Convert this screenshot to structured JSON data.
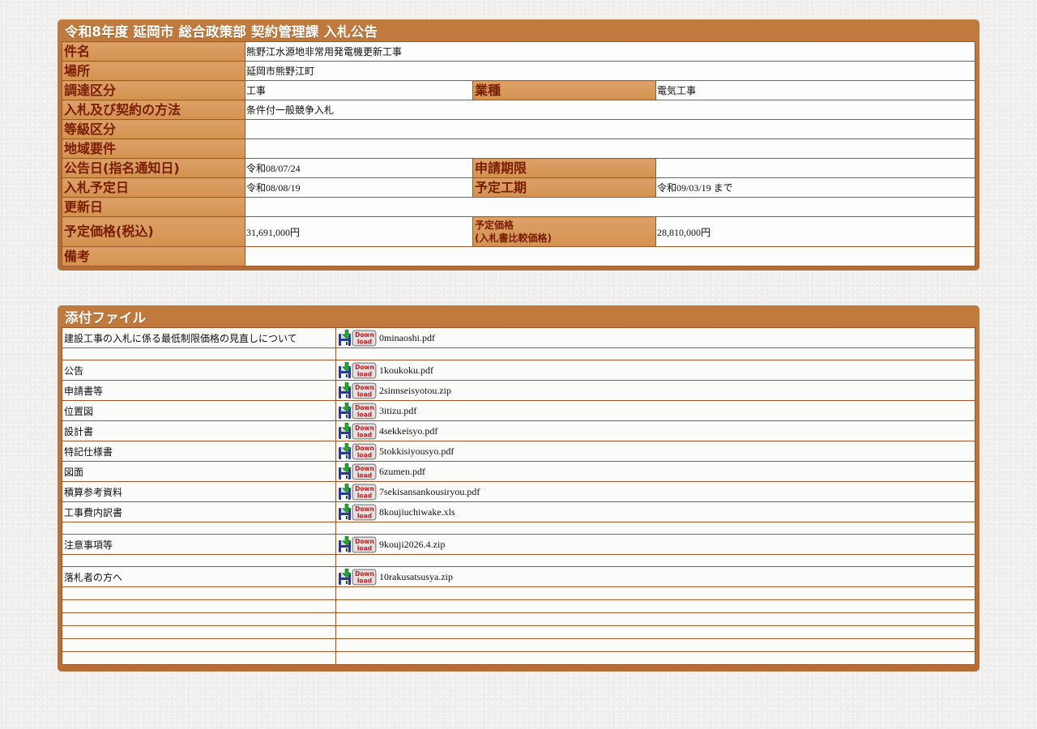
{
  "notice": {
    "title": "令和8年度 延岡市 総合政策部 契約管理課 入札公告",
    "rows": {
      "kenmei": {
        "label": "件名",
        "value": "熊野江水源地非常用発電機更新工事"
      },
      "basho": {
        "label": "場所",
        "value": "延岡市熊野江町"
      },
      "chotatsu": {
        "label": "調達区分",
        "value": "工事",
        "label2": "業種",
        "value2": "電気工事"
      },
      "houhou": {
        "label": "入札及び契約の方法",
        "value": "条件付一般競争入札"
      },
      "toukyu": {
        "label": "等級区分",
        "value": ""
      },
      "chiiki": {
        "label": "地域要件",
        "value": ""
      },
      "koukokubi": {
        "label": "公告日(指名通知日)",
        "value": "令和08/07/24",
        "label2": "申請期限",
        "value2": ""
      },
      "nyusatsubi": {
        "label": "入札予定日",
        "value": "令和08/08/19",
        "label2": "予定工期",
        "value2": "令和09/03/19 まで"
      },
      "koushin": {
        "label": "更新日",
        "value": ""
      },
      "kakaku": {
        "label": "予定価格(税込)",
        "value": "31,691,000円",
        "label2_line1": "予定価格",
        "label2_line2": "(入札書比較価格)",
        "value2": "28,810,000円"
      },
      "bikou": {
        "label": "備考",
        "value": ""
      }
    }
  },
  "attachments": {
    "title": "添付ファイル",
    "download_icon": "download-floppy-icon",
    "rows": [
      {
        "type": "file",
        "label": "建設工事の入札に係る最低制限価格の見直しについて",
        "file": "0minaoshi.pdf"
      },
      {
        "type": "blank"
      },
      {
        "type": "file",
        "label": "公告",
        "file": "1koukoku.pdf"
      },
      {
        "type": "file",
        "label": "申請書等",
        "file": "2sinnseisyotou.zip"
      },
      {
        "type": "file",
        "label": "位置図",
        "file": "3itizu.pdf"
      },
      {
        "type": "file",
        "label": "設計書",
        "file": "4sekkeisyo.pdf"
      },
      {
        "type": "file",
        "label": "特記仕様書",
        "file": "5tokkisiyousyo.pdf"
      },
      {
        "type": "file",
        "label": "図面",
        "file": "6zumen.pdf"
      },
      {
        "type": "file",
        "label": "積算参考資料",
        "file": "7sekisansankousiryou.pdf"
      },
      {
        "type": "file",
        "label": "工事費内訳書",
        "file": "8koujiuchiwake.xls"
      },
      {
        "type": "blank"
      },
      {
        "type": "file",
        "label": "注意事項等",
        "file": "9kouji2026.4.zip"
      },
      {
        "type": "blank"
      },
      {
        "type": "file",
        "label": "落札者の方へ",
        "file": "10rakusatsusya.zip"
      },
      {
        "type": "empty"
      },
      {
        "type": "empty"
      },
      {
        "type": "empty"
      },
      {
        "type": "empty"
      },
      {
        "type": "empty"
      },
      {
        "type": "empty"
      }
    ]
  },
  "colors": {
    "panel_brown": "#b9733a",
    "label_bg": "#d99a5b",
    "label_text": "#7a1d00",
    "border": "#a2542a"
  }
}
